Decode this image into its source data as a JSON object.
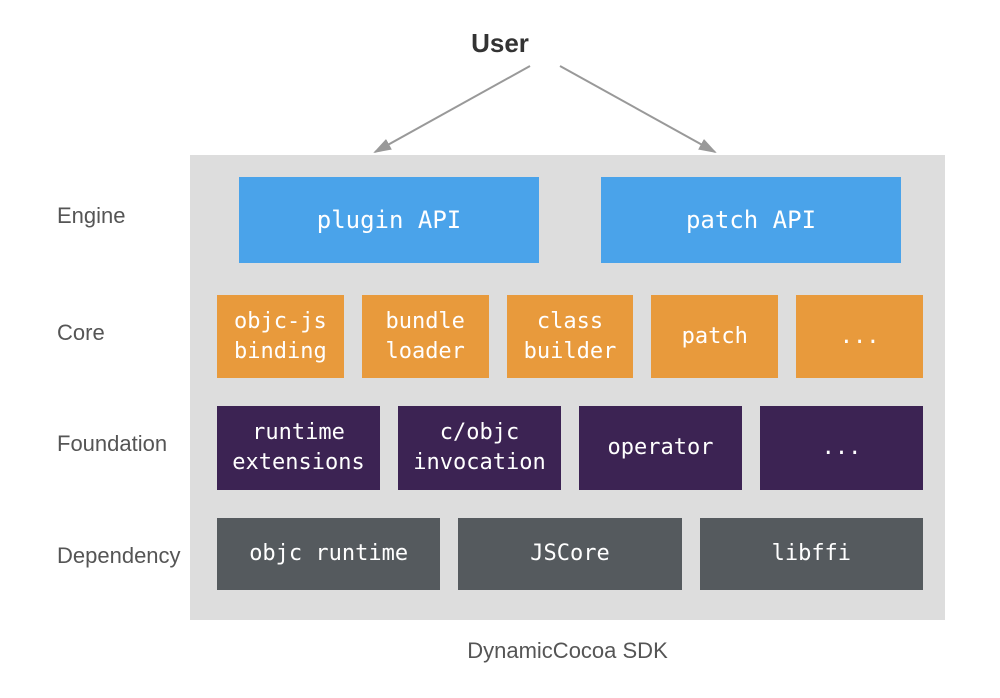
{
  "title": "User",
  "footer": "DynamicCocoa SDK",
  "rows": {
    "engine": {
      "label": "Engine",
      "items": [
        "plugin API",
        "patch API"
      ]
    },
    "core": {
      "label": "Core",
      "items": [
        "objc-js\nbinding",
        "bundle\nloader",
        "class\nbuilder",
        "patch",
        "..."
      ]
    },
    "foundation": {
      "label": "Foundation",
      "items": [
        "runtime\nextensions",
        "c/objc\ninvocation",
        "operator",
        "..."
      ]
    },
    "dependency": {
      "label": "Dependency",
      "items": [
        "objc runtime",
        "JSCore",
        "libffi"
      ]
    }
  },
  "colors": {
    "engine": "#4aa3ea",
    "core": "#e89a3c",
    "foundation": "#3c2353",
    "dependency": "#555a5e",
    "container": "#dddddd"
  }
}
